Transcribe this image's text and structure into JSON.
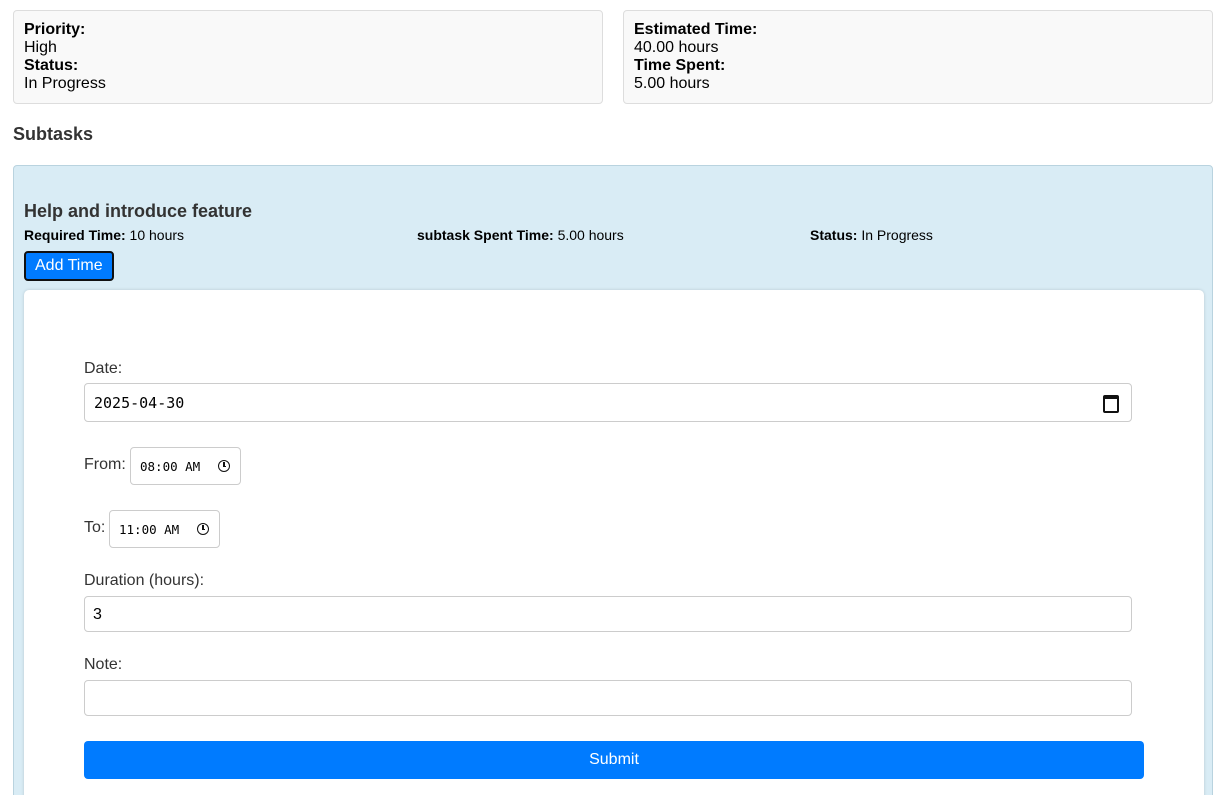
{
  "summary": {
    "priority_label": "Priority:",
    "priority_value": "High",
    "status_label": "Status:",
    "status_value": "In Progress",
    "estimated_label": "Estimated Time:",
    "estimated_value": "40.00 hours",
    "spent_label": "Time Spent:",
    "spent_value": "5.00 hours"
  },
  "subtasks_heading": "Subtasks",
  "subtask": {
    "title": "Help and introduce feature",
    "required_label": "Required Time:",
    "required_value": "10 hours",
    "spent_label": "subtask Spent Time:",
    "spent_value": "5.00 hours",
    "status_label": "Status:",
    "status_value": "In Progress",
    "add_time_label": "Add Time"
  },
  "form": {
    "date_label": "Date:",
    "date_value": "2025-04-30",
    "from_label": "From:",
    "from_value": "08:00 AM",
    "to_label": "To:",
    "to_value": "11:00 AM",
    "duration_label": "Duration (hours):",
    "duration_value": "3",
    "note_label": "Note:",
    "note_value": "",
    "submit_label": "Submit"
  },
  "colors": {
    "primary": "#007bff",
    "panel_bg": "#d9ecf5"
  }
}
